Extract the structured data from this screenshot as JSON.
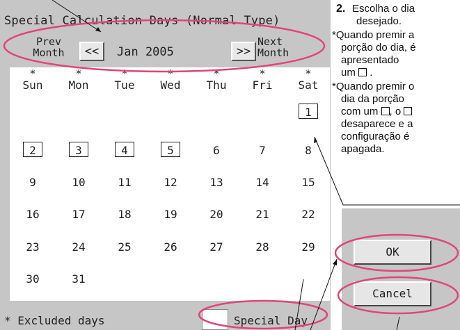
{
  "title": "Special Calculation Days (Normal Type)",
  "nav": {
    "prev_line1": "Prev",
    "prev_line2": "Month",
    "prev_button": "<<",
    "month": "Jan 2005",
    "next_button": ">>",
    "next_line1": "Next",
    "next_line2": "Month"
  },
  "excluded_mark": "*",
  "weekdays": [
    "Sun",
    "Mon",
    "Tue",
    "Wed",
    "Thu",
    "Fri",
    "Sat"
  ],
  "weeks": [
    [
      "",
      "",
      "",
      "",
      "",
      "",
      "1"
    ],
    [
      "2",
      "3",
      "4",
      "5",
      "6",
      "7",
      "8"
    ],
    [
      "9",
      "10",
      "11",
      "12",
      "13",
      "14",
      "15"
    ],
    [
      "16",
      "17",
      "18",
      "19",
      "20",
      "21",
      "22"
    ],
    [
      "23",
      "24",
      "25",
      "26",
      "27",
      "28",
      "29"
    ],
    [
      "30",
      "31",
      "",
      "",
      "",
      "",
      ""
    ]
  ],
  "special_days": [
    "1",
    "2",
    "3",
    "4",
    "5"
  ],
  "buttons": {
    "ok": "OK",
    "cancel": "Cancel"
  },
  "legend": {
    "excluded": "* Excluded days",
    "special": "Special Day"
  },
  "help": {
    "step_num": "2.",
    "step_line1": "Escolha o dia",
    "step_line2": "desejado.",
    "note1_line1": "*Quando premir a",
    "note1_line2": "porção do dia, é",
    "note1_line3": "apresentado",
    "note1_line4_pre": "um",
    "note1_line4_post": ".",
    "note2_line1": "*Quando premir o",
    "note2_line2": "dia da porção",
    "note2_line3_pre": "com um",
    "note2_line3_mid": ", o",
    "note2_line4": "desaparece e a",
    "note2_line5": "configuração é",
    "note2_line6": "apagada."
  },
  "colors": {
    "panel": "#c6c6c6",
    "highlight": "#e0457b"
  }
}
